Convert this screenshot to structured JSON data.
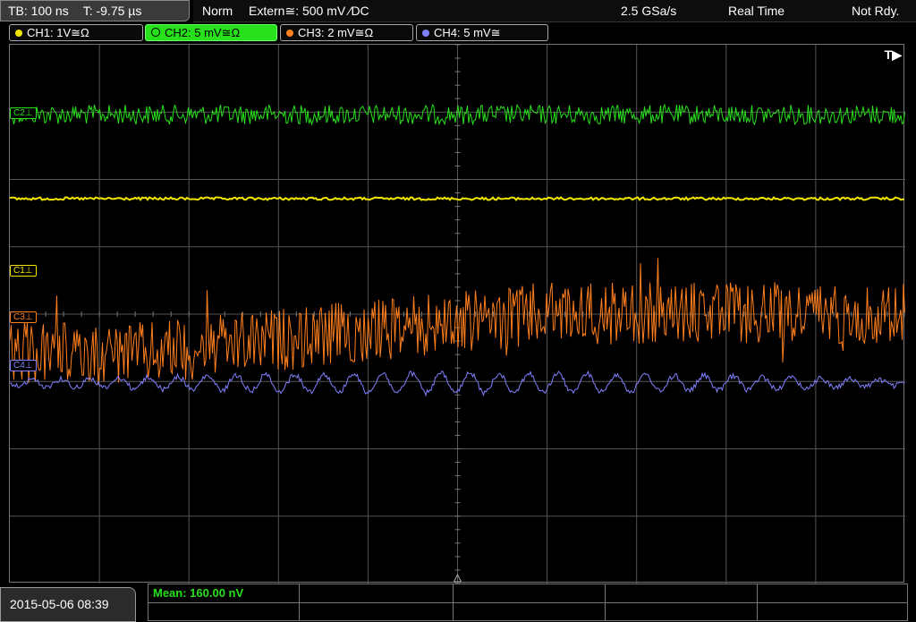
{
  "status": {
    "timebase": "TB: 100 ns",
    "trigger_time": "T: -9.75 µs",
    "mode": "Norm",
    "trigger_source": "Extern≅: 500 mV ⁄DC",
    "sample_rate": "2.5 GSa/s",
    "acq_mode": "Real Time",
    "ready": "Not Rdy."
  },
  "channels": [
    {
      "label": "CH1: 1V≅Ω",
      "color": "#f2e600"
    },
    {
      "label": "CH2: 5 mV≅Ω",
      "color": "#29e01c",
      "active": true
    },
    {
      "label": "CH3: 2 mV≅Ω",
      "color": "#ff7f1c"
    },
    {
      "label": "CH4: 5 mV≅",
      "color": "#8080ff"
    }
  ],
  "markers": {
    "c1": "C1⊥",
    "c3": "C3⊥",
    "c4": "C4⊥",
    "c2": "C2⊥"
  },
  "trigger_indicator": "T▶",
  "datetime": "2015-05-06 08:39",
  "measurement": "Mean: 160.00 nV",
  "colors": {
    "ch1": "#f2e600",
    "ch2": "#29e01c",
    "ch3": "#ff7f1c",
    "ch4": "#8080ff",
    "grid": "#555555"
  }
}
